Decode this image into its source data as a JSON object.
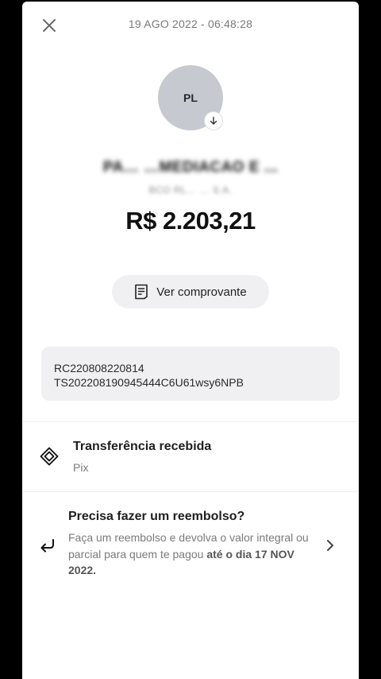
{
  "header": {
    "close_icon": "close-icon",
    "timestamp": "19 AGO 2022 - 06:48:28"
  },
  "counterparty": {
    "avatar_initials": "PL",
    "avatar_badge_icon": "download-arrow-icon",
    "name": "PA… …MEDIACAO E ...",
    "bank": "BCO RL… … S.A.",
    "name_obscured": true
  },
  "amount": "R$ 2.203,21",
  "receipt_button": {
    "icon": "receipt-icon",
    "label": "Ver comprovante"
  },
  "identifiers": {
    "line1": "RC220808220814",
    "line2": "TS202208190945444C6U61wsy6NPB"
  },
  "transfer": {
    "icon": "pix-icon",
    "title": "Transferência recebida",
    "method": "Pix"
  },
  "refund": {
    "icon": "return-arrow-icon",
    "title": "Precisa fazer um reembolso?",
    "text_prefix": "Faça um reembolso e devolva o valor integral ou parcial para quem te pagou ",
    "text_bold": "até o dia 17 NOV 2022.",
    "chevron_icon": "chevron-right-icon"
  },
  "colors": {
    "background": "#ffffff",
    "outer": "#000000",
    "avatar": "#c6c9cf",
    "pill": "#f0f0f2",
    "muted_text": "#7a7a7a"
  }
}
